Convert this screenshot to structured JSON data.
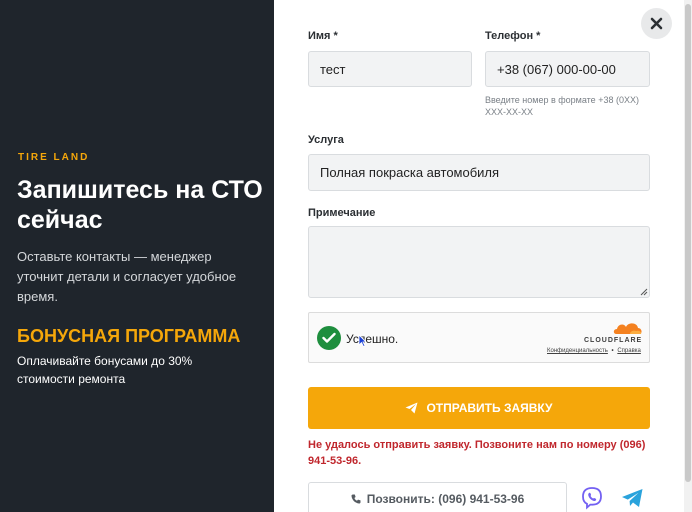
{
  "left_panel": {
    "brand": "TIRE LAND",
    "headline": "Запишитесь на СТО сейчас",
    "subtitle": "Оставьте контакты — менеджер уточнит детали и согласует удобное время.",
    "bonus_title": "БОНУСНАЯ ПРОГРАММА",
    "bonus_text": "Оплачивайте бонусами до 30% стоимости ремонта"
  },
  "form": {
    "name_label": "Имя *",
    "name_value": "тест",
    "phone_label": "Телефон *",
    "phone_value": "+38 (067) 000-00-00",
    "phone_hint": "Введите номер в формате +38 (0XX) XXX-XX-XX",
    "service_label": "Услуга",
    "service_value": "Полная покраска автомобиля",
    "note_label": "Примечание",
    "note_value": "",
    "captcha": {
      "status": "Успешно.",
      "provider": "CLOUDFLARE",
      "privacy_link": "Конфиденциальность",
      "separator": "•",
      "help_link": "Справка"
    },
    "submit_label": "ОТПРАВИТЬ ЗАЯВКУ",
    "error_message": "Не удалось отправить заявку. Позвоните нам по номеру (096) 941-53-96.",
    "call_button": "Позвонить: (096) 941-53-96"
  },
  "icons": {
    "close": "close-icon",
    "check": "check-icon",
    "send": "paper-plane-icon",
    "phone": "phone-icon",
    "viber": "viber-icon",
    "telegram": "telegram-icon",
    "cloudflare": "cloudflare-logo"
  },
  "colors": {
    "accent": "#f5a70a",
    "panel": "#1f252c",
    "error": "#c0272d",
    "success": "#1e8e3e",
    "viber": "#7360f2",
    "telegram": "#2aa3dc",
    "cloudflare": "#f48120"
  }
}
